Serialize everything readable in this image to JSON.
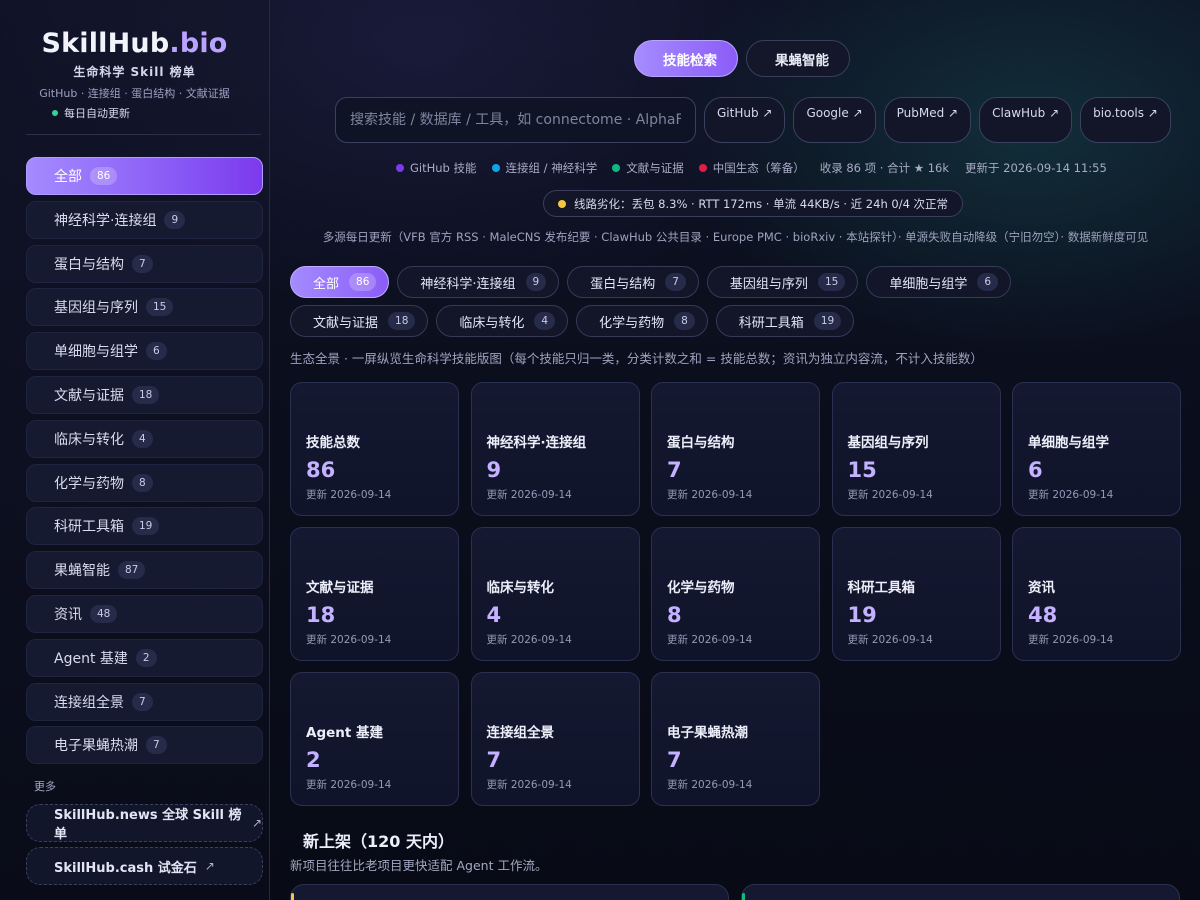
{
  "brand": {
    "name": "SkillHub",
    "tld": ".bio",
    "subtitle": "生命科学 Skill 榜单",
    "tags": "GitHub · 连接组 · 蛋白结构 · 文献证据",
    "update_note": "每日自动更新"
  },
  "sidebar": {
    "items": [
      {
        "label": "全部",
        "count": "86"
      },
      {
        "label": "神经科学·连接组",
        "count": "9"
      },
      {
        "label": "蛋白与结构",
        "count": "7"
      },
      {
        "label": "基因组与序列",
        "count": "15"
      },
      {
        "label": "单细胞与组学",
        "count": "6"
      },
      {
        "label": "文献与证据",
        "count": "18"
      },
      {
        "label": "临床与转化",
        "count": "4"
      },
      {
        "label": "化学与药物",
        "count": "8"
      },
      {
        "label": "科研工具箱",
        "count": "19"
      },
      {
        "label": "果蝇智能",
        "count": "87"
      },
      {
        "label": "资讯",
        "count": "48"
      },
      {
        "label": "Agent 基建",
        "count": "2"
      },
      {
        "label": "连接组全景",
        "count": "7"
      },
      {
        "label": "电子果蝇热潮",
        "count": "7"
      }
    ],
    "more_label": "更多",
    "external": [
      {
        "label": "SkillHub.news 全球 Skill 榜单",
        "arrow": "↗"
      },
      {
        "label": "SkillHub.cash 试金石",
        "arrow": "↗"
      }
    ]
  },
  "top_tabs": [
    {
      "label": "技能检索",
      "active": true
    },
    {
      "label": "果蝇智能",
      "active": false
    }
  ],
  "search": {
    "placeholder": "搜索技能 / 数据库 / 工具，如 connectome · AlphaFold",
    "value": ""
  },
  "quick_links": [
    "GitHub ↗",
    "Google ↗",
    "PubMed ↗",
    "ClawHub ↗",
    "bio.tools ↗"
  ],
  "legend": [
    {
      "label": "GitHub 技能",
      "color": "#7c3aed"
    },
    {
      "label": "连接组 / 神经科学",
      "color": "#0ea5e9"
    },
    {
      "label": "文献与证据",
      "color": "#10b981"
    },
    {
      "label": "中国生态（筹备）",
      "color": "#e11d48"
    }
  ],
  "stats": {
    "summary": "收录 86 项 · 合计 ★ 16k",
    "updated": "更新于 2026-09-14 11:55"
  },
  "status": {
    "text": "线路劣化：丢包 8.3% · RTT 172ms · 单流 44KB/s · 近 24h 0/4 次正常",
    "color": "#f5c542"
  },
  "sources_note": "多源每日更新（VFB 官方 RSS · MaleCNS 发布纪要 · ClawHub 公共目录 · Europe PMC · bioRxiv · 本站探针）· 单源失败自动降级（宁旧勿空）· 数据新鲜度可见",
  "filters": [
    {
      "label": "全部",
      "count": "86",
      "active": true
    },
    {
      "label": "神经科学·连接组",
      "count": "9"
    },
    {
      "label": "蛋白与结构",
      "count": "7"
    },
    {
      "label": "基因组与序列",
      "count": "15"
    },
    {
      "label": "单细胞与组学",
      "count": "6"
    },
    {
      "label": "文献与证据",
      "count": "18"
    },
    {
      "label": "临床与转化",
      "count": "4"
    },
    {
      "label": "化学与药物",
      "count": "8"
    },
    {
      "label": "科研工具箱",
      "count": "19"
    }
  ],
  "overview_note": "生态全景 · 一屏纵览生命科学技能版图（每个技能只归一类，分类计数之和 = 技能总数；资讯为独立内容流，不计入技能数）",
  "cards": [
    {
      "title": "技能总数",
      "count": "86",
      "date": "更新 2026-09-14"
    },
    {
      "title": "神经科学·连接组",
      "count": "9",
      "date": "更新 2026-09-14"
    },
    {
      "title": "蛋白与结构",
      "count": "7",
      "date": "更新 2026-09-14"
    },
    {
      "title": "基因组与序列",
      "count": "15",
      "date": "更新 2026-09-14"
    },
    {
      "title": "单细胞与组学",
      "count": "6",
      "date": "更新 2026-09-14"
    },
    {
      "title": "文献与证据",
      "count": "18",
      "date": "更新 2026-09-14"
    },
    {
      "title": "临床与转化",
      "count": "4",
      "date": "更新 2026-09-14"
    },
    {
      "title": "化学与药物",
      "count": "8",
      "date": "更新 2026-09-14"
    },
    {
      "title": "科研工具箱",
      "count": "19",
      "date": "更新 2026-09-14"
    },
    {
      "title": "资讯",
      "count": "48",
      "date": "更新 2026-09-14"
    },
    {
      "title": "Agent 基建",
      "count": "2",
      "date": "更新 2026-09-14"
    },
    {
      "title": "连接组全景",
      "count": "7",
      "date": "更新 2026-09-14"
    },
    {
      "title": "电子果蝇热潮",
      "count": "7",
      "date": "更新 2026-09-14"
    }
  ],
  "new_section": {
    "title": "新上架（120 天内）",
    "subtitle": "新项目往往比老项目更快适配 Agent 工作流。",
    "accent_colors": [
      "#f5c542",
      "#10b981"
    ]
  }
}
